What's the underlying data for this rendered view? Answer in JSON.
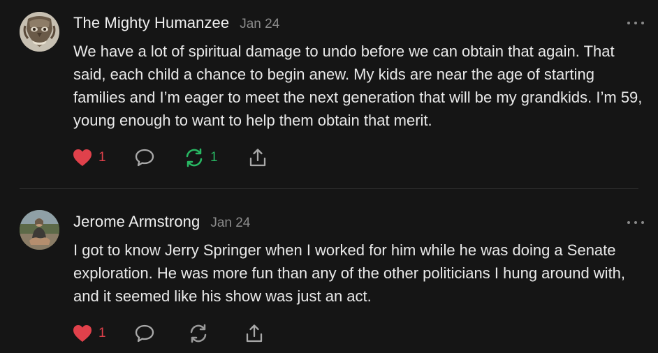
{
  "comments": [
    {
      "author": "The Mighty Humanzee",
      "date": "Jan 24",
      "body": "We have a lot of spiritual damage to undo before we can obtain that again. That said, each child a chance to begin anew. My kids are near the age of starting families and I’m eager to meet the next generation that will be my grandkids. I’m 59, young enough to want to help them obtain that merit.",
      "likes": "1",
      "restacks": "1",
      "icons": {
        "like": "heart-icon",
        "comment": "comment-bubble-icon",
        "restack": "restack-icon",
        "share": "share-icon",
        "more": "more-options-icon"
      },
      "colors": {
        "like": "#e0414b",
        "restack": "#28b863"
      }
    },
    {
      "author": "Jerome Armstrong",
      "date": "Jan 24",
      "body": "I got to know Jerry Springer when I worked for him while he was doing a Senate exploration. He was more fun than any of the other politicians I hung around with, and it seemed like his show was just an act.",
      "likes": "1",
      "restacks": "",
      "icons": {
        "like": "heart-icon",
        "comment": "comment-bubble-icon",
        "restack": "restack-icon",
        "share": "share-icon",
        "more": "more-options-icon"
      },
      "colors": {
        "like": "#e0414b",
        "restack": "#9a9a9a"
      }
    }
  ]
}
